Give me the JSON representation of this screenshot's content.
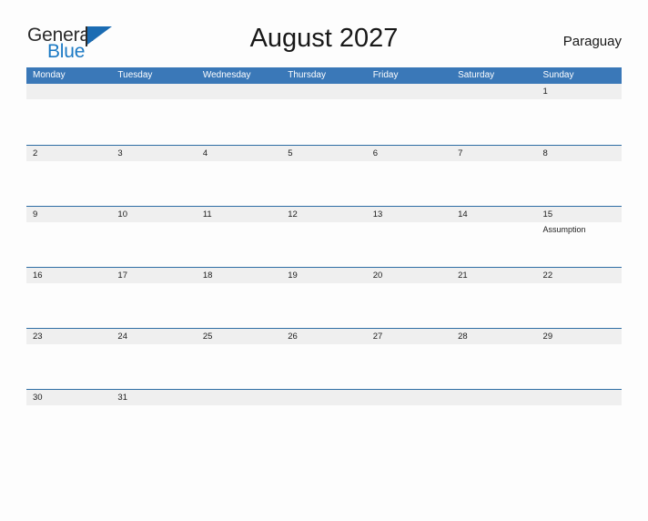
{
  "brand": {
    "name_part1": "General",
    "name_part2": "Blue",
    "flag_icon": "blue-flag-icon",
    "color_dark": "#2b2b2b",
    "color_blue": "#1b79c4"
  },
  "header": {
    "title": "August 2027",
    "country": "Paraguay"
  },
  "colors": {
    "header_blue": "#3a78b8",
    "rule_blue": "#2e6da4",
    "day_band_gray": "#efefef",
    "page_background": "#fdfdfd",
    "text": "#1c1c1c"
  },
  "calendar": {
    "weekdays": [
      "Monday",
      "Tuesday",
      "Wednesday",
      "Thursday",
      "Friday",
      "Saturday",
      "Sunday"
    ],
    "weeks": [
      [
        {
          "num": "",
          "event": ""
        },
        {
          "num": "",
          "event": ""
        },
        {
          "num": "",
          "event": ""
        },
        {
          "num": "",
          "event": ""
        },
        {
          "num": "",
          "event": ""
        },
        {
          "num": "",
          "event": ""
        },
        {
          "num": "1",
          "event": ""
        }
      ],
      [
        {
          "num": "2",
          "event": ""
        },
        {
          "num": "3",
          "event": ""
        },
        {
          "num": "4",
          "event": ""
        },
        {
          "num": "5",
          "event": ""
        },
        {
          "num": "6",
          "event": ""
        },
        {
          "num": "7",
          "event": ""
        },
        {
          "num": "8",
          "event": ""
        }
      ],
      [
        {
          "num": "9",
          "event": ""
        },
        {
          "num": "10",
          "event": ""
        },
        {
          "num": "11",
          "event": ""
        },
        {
          "num": "12",
          "event": ""
        },
        {
          "num": "13",
          "event": ""
        },
        {
          "num": "14",
          "event": ""
        },
        {
          "num": "15",
          "event": "Assumption"
        }
      ],
      [
        {
          "num": "16",
          "event": ""
        },
        {
          "num": "17",
          "event": ""
        },
        {
          "num": "18",
          "event": ""
        },
        {
          "num": "19",
          "event": ""
        },
        {
          "num": "20",
          "event": ""
        },
        {
          "num": "21",
          "event": ""
        },
        {
          "num": "22",
          "event": ""
        }
      ],
      [
        {
          "num": "23",
          "event": ""
        },
        {
          "num": "24",
          "event": ""
        },
        {
          "num": "25",
          "event": ""
        },
        {
          "num": "26",
          "event": ""
        },
        {
          "num": "27",
          "event": ""
        },
        {
          "num": "28",
          "event": ""
        },
        {
          "num": "29",
          "event": ""
        }
      ],
      [
        {
          "num": "30",
          "event": ""
        },
        {
          "num": "31",
          "event": ""
        },
        {
          "num": "",
          "event": ""
        },
        {
          "num": "",
          "event": ""
        },
        {
          "num": "",
          "event": ""
        },
        {
          "num": "",
          "event": ""
        },
        {
          "num": "",
          "event": ""
        }
      ]
    ]
  }
}
